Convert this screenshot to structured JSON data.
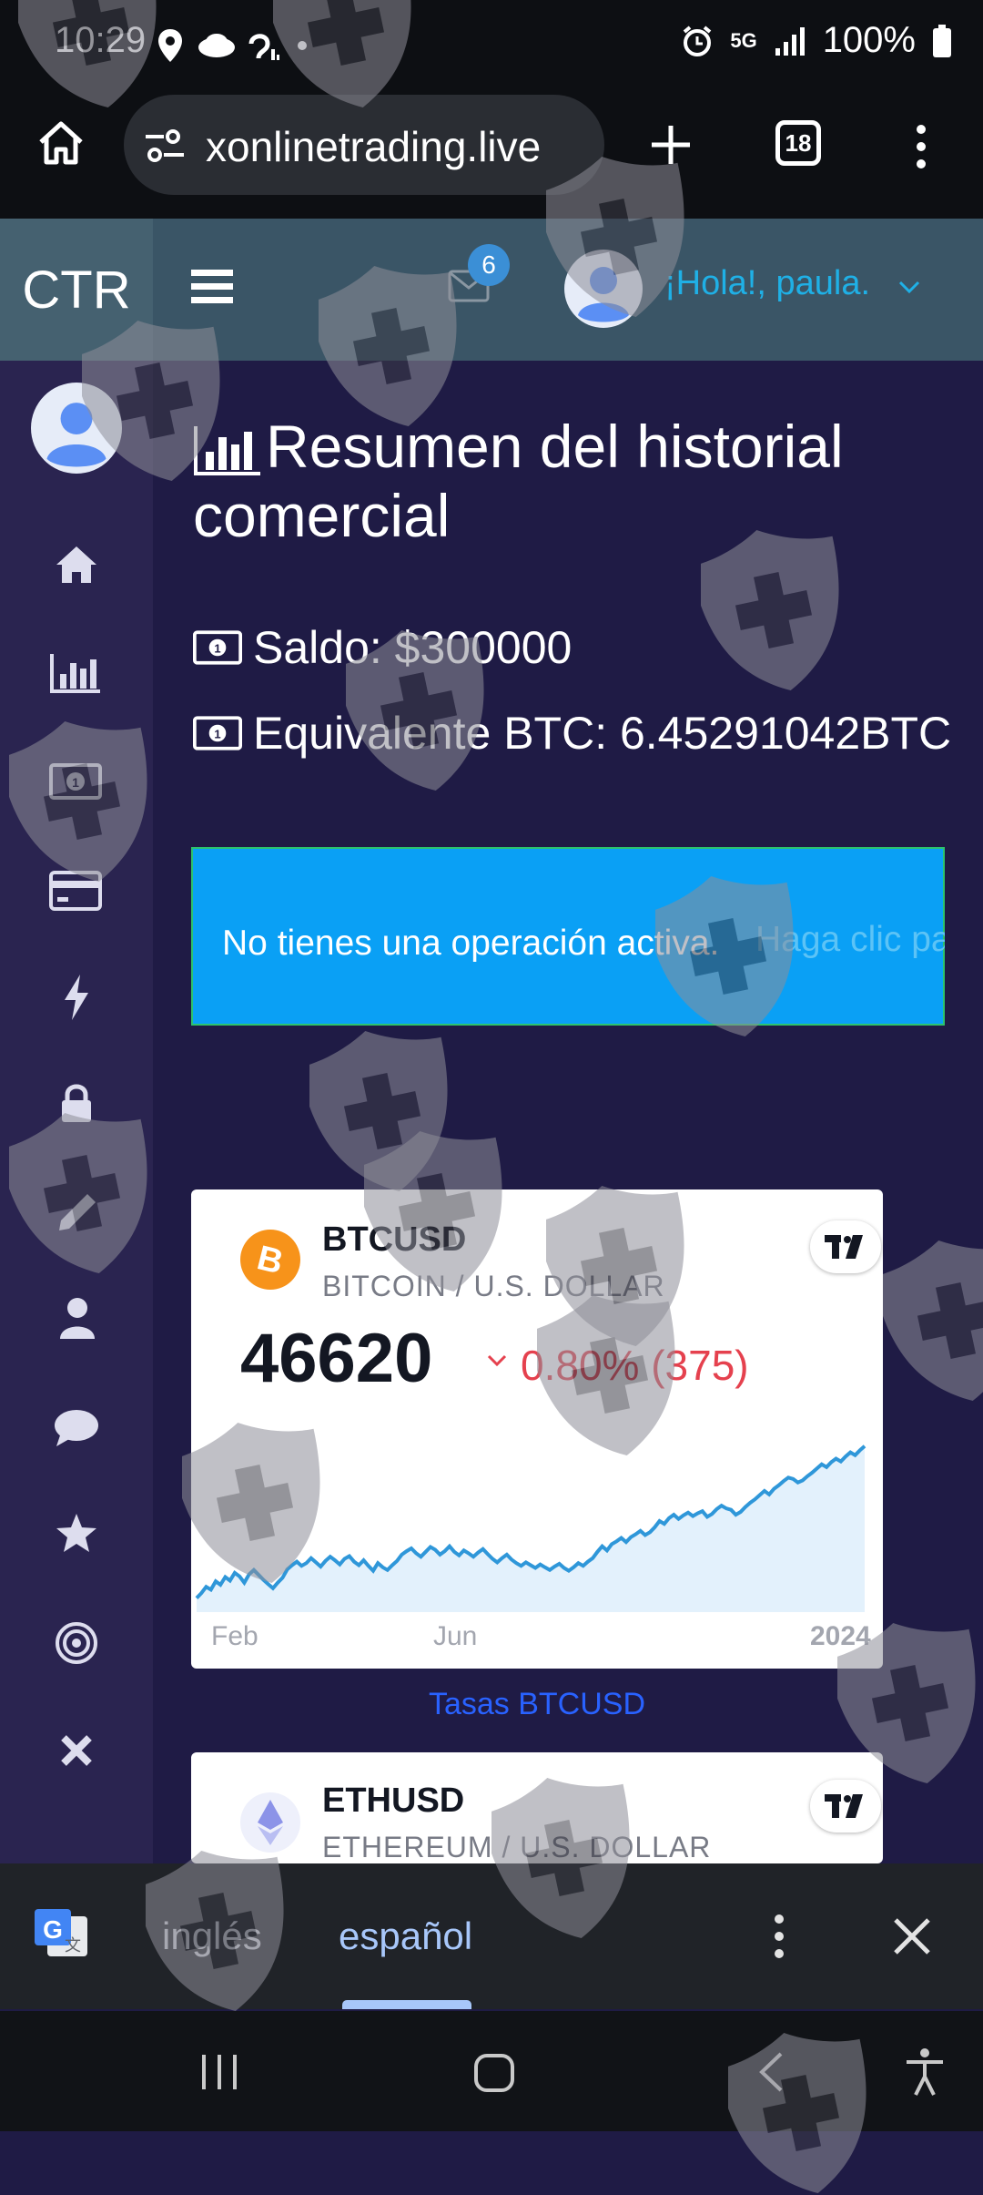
{
  "status_bar": {
    "time": "10:29",
    "network": "5G",
    "battery": "100%"
  },
  "browser": {
    "url": "xonlinetrading.live",
    "tab_count": "18"
  },
  "app_header": {
    "brand": "CTR",
    "notification_count": "6",
    "greeting": "¡Hola!, paula."
  },
  "main": {
    "title": "Resumen del historial comercial",
    "balance": "Saldo: $300000",
    "btc_equivalent": "Equivalente BTC: 6.45291042BTC",
    "alert": {
      "message": "No tienes una operación activa.",
      "faded_text": "Haga clic para"
    }
  },
  "ticker_btc": {
    "symbol": "BTCUSD",
    "pair": "BITCOIN / U.S. DOLLAR",
    "price": "46620",
    "change": "0.80% (375)",
    "axis": [
      "Feb",
      "Jun",
      "2024"
    ],
    "link": "Tasas BTCUSD",
    "sparkline": [
      36.2,
      36.9,
      37.8,
      37.4,
      38.6,
      38.1,
      39.2,
      38.7,
      39.8,
      39.3,
      38.4,
      39.6,
      40.2,
      39.5,
      38.8,
      38.2,
      37.6,
      38.4,
      39.1,
      40.3,
      40.9,
      41.4,
      40.8,
      41.2,
      41.9,
      41.3,
      40.7,
      41.5,
      42.1,
      41.6,
      41.0,
      41.8,
      42.2,
      41.4,
      40.9,
      41.6,
      40.8,
      40.1,
      41.2,
      40.6,
      40.2,
      40.9,
      41.5,
      42.4,
      42.9,
      43.3,
      42.6,
      42.1,
      42.8,
      43.5,
      43.1,
      42.4,
      42.9,
      43.6,
      42.8,
      42.3,
      43.0,
      42.6,
      42.1,
      42.7,
      43.2,
      42.5,
      41.8,
      41.3,
      41.9,
      42.4,
      41.7,
      41.2,
      40.8,
      41.3,
      40.9,
      40.5,
      41.0,
      40.6,
      40.2,
      40.7,
      41.1,
      40.5,
      40.1,
      40.6,
      41.2,
      40.8,
      41.4,
      41.9,
      42.8,
      43.6,
      43.0,
      43.9,
      44.3,
      44.8,
      44.2,
      44.9,
      45.3,
      45.8,
      45.2,
      45.6,
      46.3,
      47.2,
      46.8,
      47.6,
      48.1,
      47.5,
      48.0,
      48.4,
      47.9,
      48.3,
      48.6,
      47.8,
      48.2,
      48.9,
      49.4,
      49.0,
      48.8,
      48.1,
      48.5,
      49.2,
      49.8,
      50.3,
      50.9,
      51.5,
      51.0,
      51.8,
      52.3,
      52.9,
      53.4,
      53.2,
      52.7,
      53.0,
      53.6,
      54.1,
      54.7,
      55.3,
      54.9,
      55.6,
      56.1,
      55.7,
      56.4,
      57.0,
      56.6,
      57.3,
      57.9
    ]
  },
  "ticker_eth": {
    "symbol": "ETHUSD",
    "pair": "ETHEREUM / U.S. DOLLAR"
  },
  "translate_bar": {
    "lang_from": "inglés",
    "lang_to": "español"
  },
  "icons": [
    "home-icon",
    "chart-bar-icon",
    "money-bill-icon",
    "credit-card-icon",
    "bolt-icon",
    "lock-icon",
    "pencil-icon",
    "user-icon",
    "comment-icon",
    "star-icon",
    "bullseye-icon",
    "times-icon"
  ]
}
